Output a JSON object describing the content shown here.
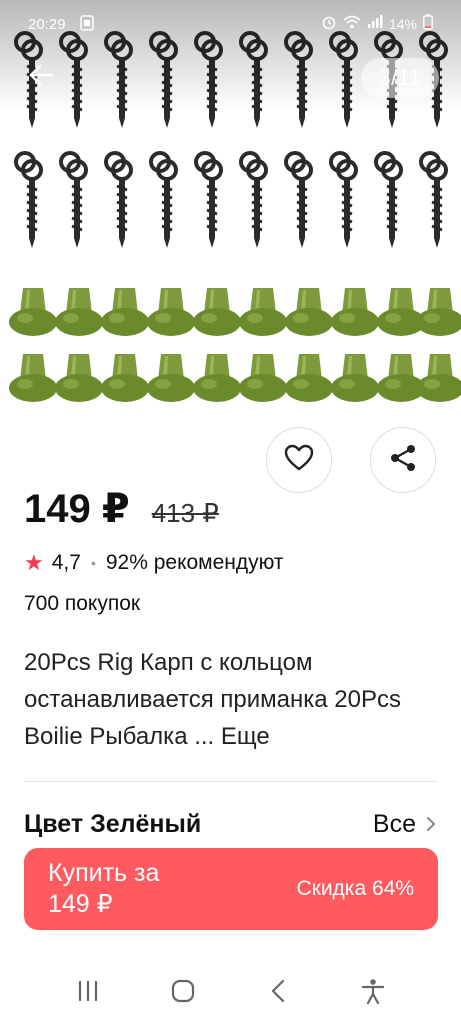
{
  "status_bar": {
    "time": "20:29",
    "battery": "14%"
  },
  "gallery": {
    "counter": "3/11"
  },
  "product": {
    "price": "149 ₽",
    "old_price": "413 ₽",
    "rating": "4,7",
    "recommend": "92% рекомендуют",
    "purchases": "700 покупок",
    "title": "20Pcs Rig Карп с кольцом останавливается приманка 20Pcs Boilie Рыбалка ...",
    "more_label": "Еще"
  },
  "options": {
    "color_label": "Цвет Зелёный",
    "all_label": "Все"
  },
  "buy": {
    "label_line1": "Купить за",
    "label_line2": "149 ₽",
    "discount": "Скидка 64%"
  },
  "colors": {
    "accent": "#ff5a60",
    "star": "#f23b4e",
    "bead_green": "#6b8a2c",
    "screw_dark": "#2b2b2b"
  },
  "icons": [
    "back-arrow-icon",
    "heart-icon",
    "share-icon",
    "star-icon",
    "chevron-right-icon",
    "recents-icon",
    "home-icon",
    "nav-back-icon",
    "accessibility-icon"
  ]
}
